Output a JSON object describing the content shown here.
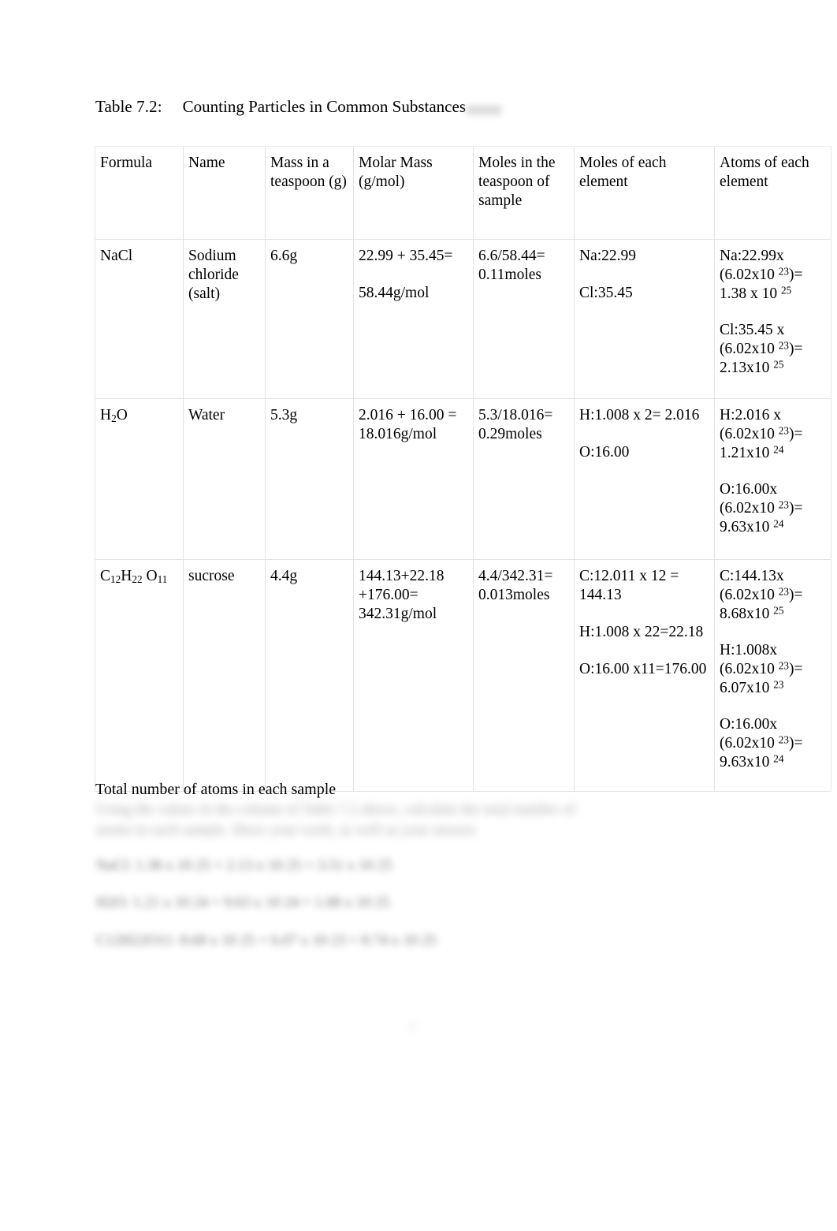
{
  "document": {
    "title_label": "Table 7.2:",
    "title_text": "Counting Particles in Common Substances",
    "page_number": "2"
  },
  "table": {
    "headers": [
      "Formula",
      "Name",
      "Mass in a teaspoon (g)",
      "Molar Mass (g/mol)",
      "Moles in the teaspoon of sample",
      "Moles of each element",
      "Atoms of each element"
    ],
    "rows": [
      {
        "formula_main": "NaCl",
        "name": "Sodium chloride (salt)",
        "mass": "6.6g",
        "molar_mass_line1": "22.99 + 35.45=",
        "molar_mass_line2": "58.44g/mol",
        "moles": "6.6/58.44= 0.11moles",
        "element_moles_1": "Na:22.99",
        "element_moles_2": "Cl:35.45",
        "atoms_1_a": "Na:22.99x (6.02x10",
        "atoms_1_exp1": "23",
        "atoms_1_b": ")= 1.38 x 10",
        "atoms_1_exp2": "25",
        "atoms_2_a": "Cl:35.45 x (6.02x10",
        "atoms_2_exp1": "23",
        "atoms_2_b": ")= 2.13x10",
        "atoms_2_exp2": "25"
      },
      {
        "formula_main": "H",
        "formula_sub": "2",
        "formula_tail": "O",
        "name": "Water",
        "mass": "5.3g",
        "molar_mass_line1": "2.016 + 16.00 =",
        "molar_mass_line2": "18.016g/mol",
        "moles": "5.3/18.016= 0.29moles",
        "element_moles_1": "H:1.008 x 2= 2.016",
        "element_moles_2": "O:16.00",
        "atoms_1_a": "H:2.016 x (6.02x10",
        "atoms_1_exp1": "23",
        "atoms_1_b": ")= 1.21x10",
        "atoms_1_exp2": "24",
        "atoms_2_a": "O:16.00x (6.02x10",
        "atoms_2_exp1": "23",
        "atoms_2_b": ")= 9.63x10",
        "atoms_2_exp2": "24"
      },
      {
        "formula_c": "C",
        "formula_c_sub": "12",
        "formula_h": "H",
        "formula_h_sub": "22",
        "formula_o": "O",
        "formula_o_sub": "11",
        "name": "sucrose",
        "mass": "4.4g",
        "molar_mass_line1": "144.13+22.18 +176.00=",
        "molar_mass_line2": "342.31g/mol",
        "moles": "4.4/342.31= 0.013moles",
        "element_moles_1": "C:12.011 x 12 = 144.13",
        "element_moles_2": "H:1.008 x 22=22.18",
        "element_moles_3": "O:16.00 x11=176.00",
        "atoms_1_a": "C:144.13x (6.02x10",
        "atoms_1_exp1": "23",
        "atoms_1_b": ")= 8.68x10",
        "atoms_1_exp2": "25",
        "atoms_2_a": "H:1.008x (6.02x10",
        "atoms_2_exp1": "23",
        "atoms_2_b": ")= 6.07x10",
        "atoms_2_exp2": "23",
        "atoms_3_a": "O:16.00x (6.02x10",
        "atoms_3_exp1": "23",
        "atoms_3_b": ")= 9.63x10",
        "atoms_3_exp2": "24"
      }
    ]
  },
  "footer": {
    "total_label": "Total number of atoms in each sample",
    "blurred_line_1": "Using the values in the column of Table 7.2 above, calculate the total number of",
    "blurred_line_2": "atoms in each sample. Show your work, as well as your answer.",
    "blurred_answer_1": "NaCl: 1.38 x 10 25 + 2.13 x 10 25 = 3.51 x 10 25",
    "blurred_answer_2": "H2O: 1.21 x 10 24 + 9.63 x 10 24 = 1.08 x 10 25",
    "blurred_answer_3": "C12H22O11: 8.68 x 10 25 + 6.07 x 10 23 = 8.74 x 10 25"
  }
}
